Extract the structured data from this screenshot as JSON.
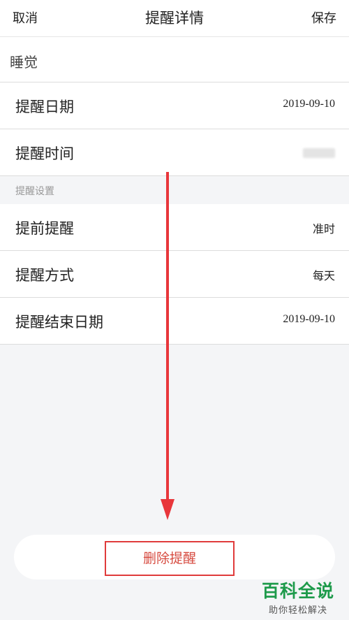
{
  "header": {
    "cancel_label": "取消",
    "title": "提醒详情",
    "save_label": "保存"
  },
  "reminder_name": "睡觉",
  "rows": {
    "date": {
      "label": "提醒日期",
      "value": "2019-09-10"
    },
    "time": {
      "label": "提醒时间"
    }
  },
  "settings": {
    "section_title": "提醒设置",
    "advance": {
      "label": "提前提醒",
      "value": "准时"
    },
    "method": {
      "label": "提醒方式",
      "value": "每天"
    },
    "end_date": {
      "label": "提醒结束日期",
      "value": "2019-09-10"
    }
  },
  "delete_label": "删除提醒",
  "watermark": {
    "title": "百科全说",
    "subtitle": "助你轻松解决"
  },
  "colors": {
    "highlight_red": "#e03b3b",
    "delete_text": "#d64a3f",
    "watermark_green": "#1d9a4a"
  }
}
